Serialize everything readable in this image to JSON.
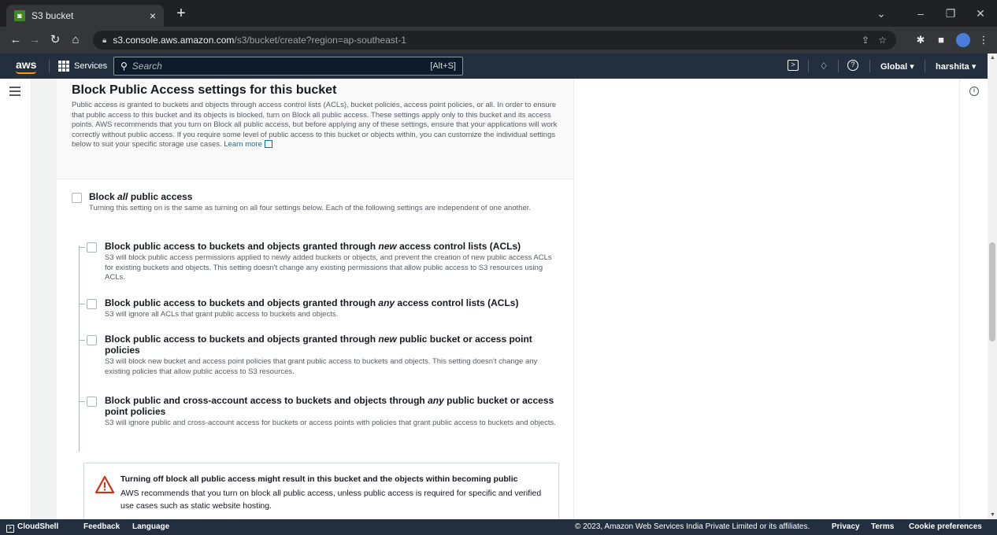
{
  "browser": {
    "tab_title": "S3 bucket",
    "tab_close": "×",
    "new_tab": "+",
    "url_host": "s3.console.aws.amazon.com",
    "url_path": "/s3/bucket/create?region=ap-southeast-1",
    "window_controls": {
      "minimize": "‒",
      "restore": "❐",
      "close": "✕",
      "tabsearch": "⌄"
    }
  },
  "aws_nav": {
    "logo": "aws",
    "services_label": "Services",
    "search_placeholder": "Search",
    "search_shortcut": "[Alt+S]",
    "region": "Global ▾",
    "user": "harshita ▾"
  },
  "section": {
    "title": "Block Public Access settings for this bucket",
    "description": "Public access is granted to buckets and objects through access control lists (ACLs), bucket policies, access point policies, or all. In order to ensure that public access to this bucket and its objects is blocked, turn on Block all public access. These settings apply only to this bucket and its access points. AWS recommends that you turn on Block all public access, but before applying any of these settings, ensure that your applications will work correctly without public access. If you require some level of public access to this bucket or objects within, you can customize the individual settings below to suit your specific storage use cases.",
    "learn_more": "Learn more"
  },
  "options": {
    "block_all": {
      "title_pre": "Block ",
      "title_em": "all",
      "title_post": " public access",
      "description": "Turning this setting on is the same as turning on all four settings below. Each of the following settings are independent of one another.",
      "checked": false
    },
    "new_acls": {
      "title_pre": "Block public access to buckets and objects granted through ",
      "title_em": "new",
      "title_post": " access control lists (ACLs)",
      "description": "S3 will block public access permissions applied to newly added buckets or objects, and prevent the creation of new public access ACLs for existing buckets and objects. This setting doesn't change any existing permissions that allow public access to S3 resources using ACLs.",
      "checked": false
    },
    "any_acls": {
      "title_pre": "Block public access to buckets and objects granted through ",
      "title_em": "any",
      "title_post": " access control lists (ACLs)",
      "description": "S3 will ignore all ACLs that grant public access to buckets and objects.",
      "checked": false
    },
    "new_policies": {
      "title_pre": "Block public access to buckets and objects granted through ",
      "title_em": "new",
      "title_post": " public bucket or access point policies",
      "description": "S3 will block new bucket and access point policies that grant public access to buckets and objects. This setting doesn't change any existing policies that allow public access to S3 resources.",
      "checked": false
    },
    "any_policies": {
      "title_pre": "Block public and cross-account access to buckets and objects through ",
      "title_em": "any",
      "title_post": " public bucket or access point policies",
      "description": "S3 will ignore public and cross-account access for buckets or access points with policies that grant public access to buckets and objects.",
      "checked": false
    }
  },
  "warning": {
    "title": "Turning off block all public access might result in this bucket and the objects within becoming public",
    "description": "AWS recommends that you turn on block all public access, unless public access is required for specific and verified use cases such as static website hosting."
  },
  "footer": {
    "cloudshell": "CloudShell",
    "feedback": "Feedback",
    "language": "Language",
    "copyright": "© 2023, Amazon Web Services India Private Limited or its affiliates.",
    "privacy": "Privacy",
    "terms": "Terms",
    "cookie": "Cookie preferences"
  },
  "colors": {
    "aws_nav": "#232f3e",
    "aws_orange": "#ff9900",
    "link": "#0073bb",
    "warning_red": "#d13212"
  }
}
